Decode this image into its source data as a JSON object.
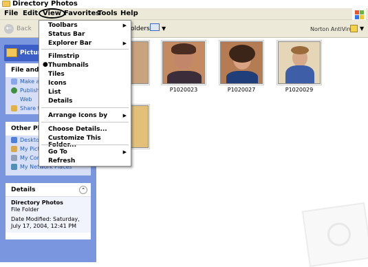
{
  "window": {
    "title": "Directory Photos"
  },
  "menubar": {
    "items": [
      "File",
      "Edit",
      "View",
      "Favorites",
      "Tools",
      "Help"
    ]
  },
  "toolbar": {
    "back_label": "Back",
    "folders_label": "olders",
    "norton_label": "Norton AntiVirus"
  },
  "sidebar": {
    "badge_label": "Picture",
    "file_tasks": {
      "header": "File and Fo",
      "items": [
        "Make a",
        "Publish",
        "Web",
        "Share t"
      ]
    },
    "other_places": {
      "header": "Other Plac",
      "items": [
        "Deskto",
        "My Pict",
        "My Cor",
        "My Network Places"
      ]
    },
    "details": {
      "header": "Details",
      "name": "Directory Photos",
      "type": "File Folder",
      "modified": "Date Modified: Saturday, July 17, 2004, 12:41 PM"
    }
  },
  "files": [
    {
      "name": "22",
      "color": "#c9a27e"
    },
    {
      "name": "P1020023",
      "color": "#8a5a46"
    },
    {
      "name": "P1020027",
      "color": "#6b4b3b"
    },
    {
      "name": "P1020029",
      "color": "#3e5a8a"
    },
    {
      "name": "45",
      "color": "#e6c27a"
    }
  ],
  "view_menu": {
    "items": [
      {
        "label": "Toolbars",
        "submenu": true
      },
      {
        "label": "Status Bar"
      },
      {
        "label": "Explorer Bar",
        "submenu": true
      },
      {
        "label": "Filmstrip"
      },
      {
        "label": "Thumbnails",
        "selected": true
      },
      {
        "label": "Tiles"
      },
      {
        "label": "Icons"
      },
      {
        "label": "List"
      },
      {
        "label": "Details"
      },
      {
        "label": "Arrange Icons by",
        "submenu": true
      },
      {
        "label": "Choose Details..."
      },
      {
        "label": "Customize This Folder..."
      },
      {
        "label": "Go To",
        "submenu": true
      },
      {
        "label": "Refresh"
      }
    ]
  }
}
